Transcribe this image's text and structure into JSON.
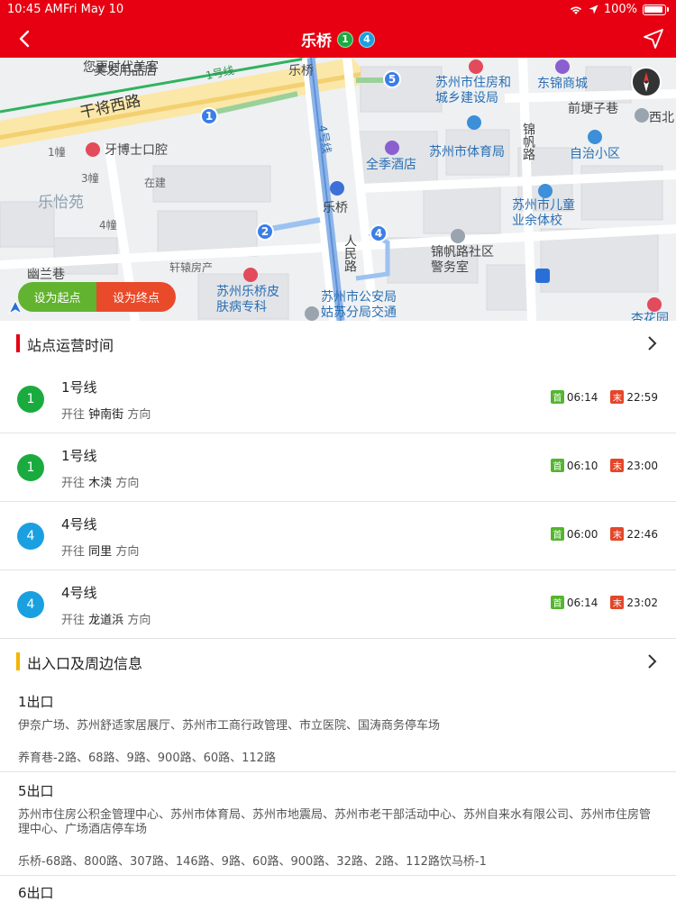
{
  "status_bar": {
    "time": "10:45 AM",
    "date": "Fri May 10",
    "battery": "100%"
  },
  "nav": {
    "title": "乐桥",
    "lines": [
      {
        "label": "1",
        "color": "#1aab3f"
      },
      {
        "label": "4",
        "color": "#1aa0e0"
      }
    ]
  },
  "map": {
    "labels": {
      "road_ganjiang": "干将西路",
      "line1": "1号线",
      "line4": "4号线",
      "leqiao_top": "乐桥",
      "leqiao_station": "乐桥",
      "renmin": "人民路",
      "jinfan": "锦帆路",
      "hotel": "全季酒店",
      "sports": "苏州市体育局",
      "housing": "苏州市住房和城乡建设局",
      "dongjin": "东锦商城",
      "qianmian": "前埂子巷",
      "xibei": "西北",
      "zizhi": "自治小区",
      "children": "苏州市儿童业余体校",
      "police": "锦帆路社区警务室",
      "dental": "牙博士口腔",
      "leyiyuan": "乐怡苑",
      "youlan": "幽兰巷",
      "xuanyuan": "轩辕房产",
      "skin": "苏州乐桥皮肤病专科",
      "public_security": "苏州市公安局姑苏分局交通",
      "meiyou": "美发用品店",
      "top_left": "您更时代美客",
      "building1": "1幢",
      "building3": "3幢",
      "building4": "4幢",
      "zaijian": "在建",
      "xinghe": "杏花园"
    },
    "exit_markers": [
      "1",
      "2",
      "4",
      "5"
    ],
    "set_start": "设为起点",
    "set_end": "设为终点"
  },
  "schedule": {
    "title": "站点运营时间",
    "first_tag": "首",
    "last_tag": "末",
    "direction_prefix": "开往",
    "direction_suffix": "方向",
    "rows": [
      {
        "line": "1",
        "name": "1号线",
        "dest": "钟南街",
        "first": "06:14",
        "last": "22:59",
        "color": "#1aab3f"
      },
      {
        "line": "1",
        "name": "1号线",
        "dest": "木渎",
        "first": "06:10",
        "last": "23:00",
        "color": "#1aab3f"
      },
      {
        "line": "4",
        "name": "4号线",
        "dest": "同里",
        "first": "06:00",
        "last": "22:46",
        "color": "#1aa0e0"
      },
      {
        "line": "4",
        "name": "4号线",
        "dest": "龙道浜",
        "first": "06:14",
        "last": "23:02",
        "color": "#1aa0e0"
      }
    ]
  },
  "exits": {
    "title": "出入口及周边信息",
    "items": [
      {
        "name": "1出口",
        "places": "伊奈广场、苏州舒适家居展厅、苏州市工商行政管理、市立医院、国涛商务停车场",
        "buses": "养育巷-2路、68路、9路、900路、60路、112路"
      },
      {
        "name": "5出口",
        "places": "苏州市住房公积金管理中心、苏州市体育局、苏州市地震局、苏州市老干部活动中心、苏州自来水有限公司、苏州市住房管理中心、广场酒店停车场",
        "buses": "乐桥-68路、800路、307路、146路、9路、60路、900路、32路、2路、112路饮马桥-1"
      },
      {
        "name": "6出口",
        "places": "",
        "buses": ""
      }
    ]
  }
}
